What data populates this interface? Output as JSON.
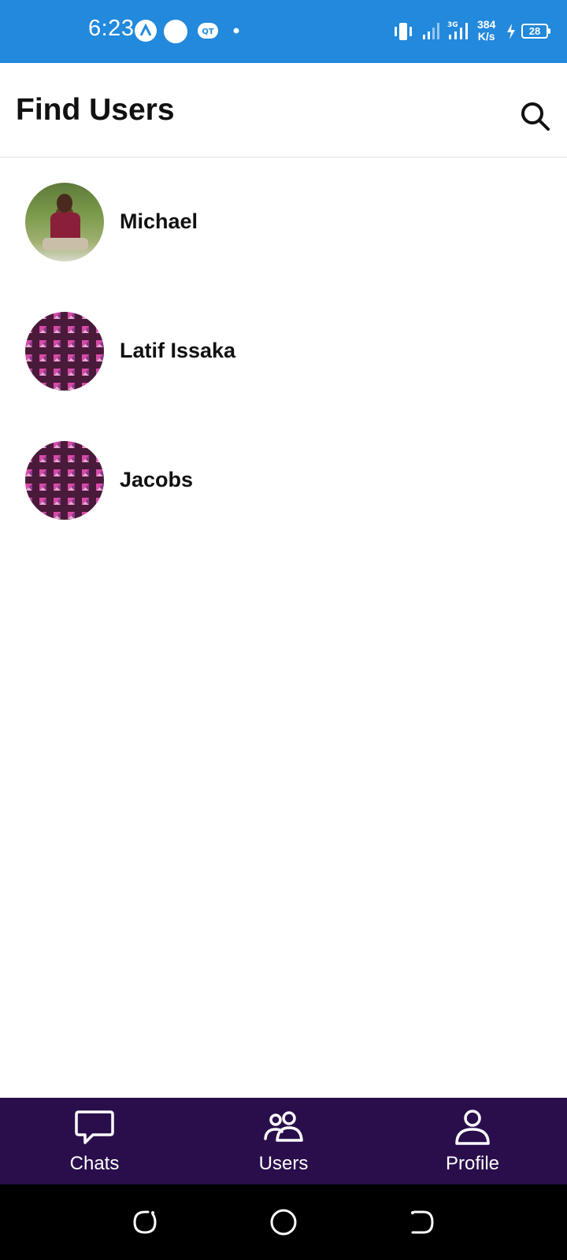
{
  "status_bar": {
    "time": "6:23",
    "speed_value": "384",
    "speed_unit": "K/s",
    "battery": "28",
    "background": "#2289dc"
  },
  "header": {
    "title": "Find Users",
    "search_icon": "search-icon"
  },
  "users": [
    {
      "name": "Michael",
      "avatar": "photo"
    },
    {
      "name": "Latif Issaka",
      "avatar": "cubes-pattern"
    },
    {
      "name": "Jacobs",
      "avatar": "cubes-pattern"
    }
  ],
  "bottom_nav": {
    "background": "#2a0e4c",
    "items": [
      {
        "label": "Chats",
        "icon": "chat-bubble-icon"
      },
      {
        "label": "Users",
        "icon": "users-icon"
      },
      {
        "label": "Profile",
        "icon": "profile-icon"
      }
    ]
  },
  "system_nav": {
    "items": [
      "recents-icon",
      "home-icon",
      "back-icon"
    ]
  }
}
